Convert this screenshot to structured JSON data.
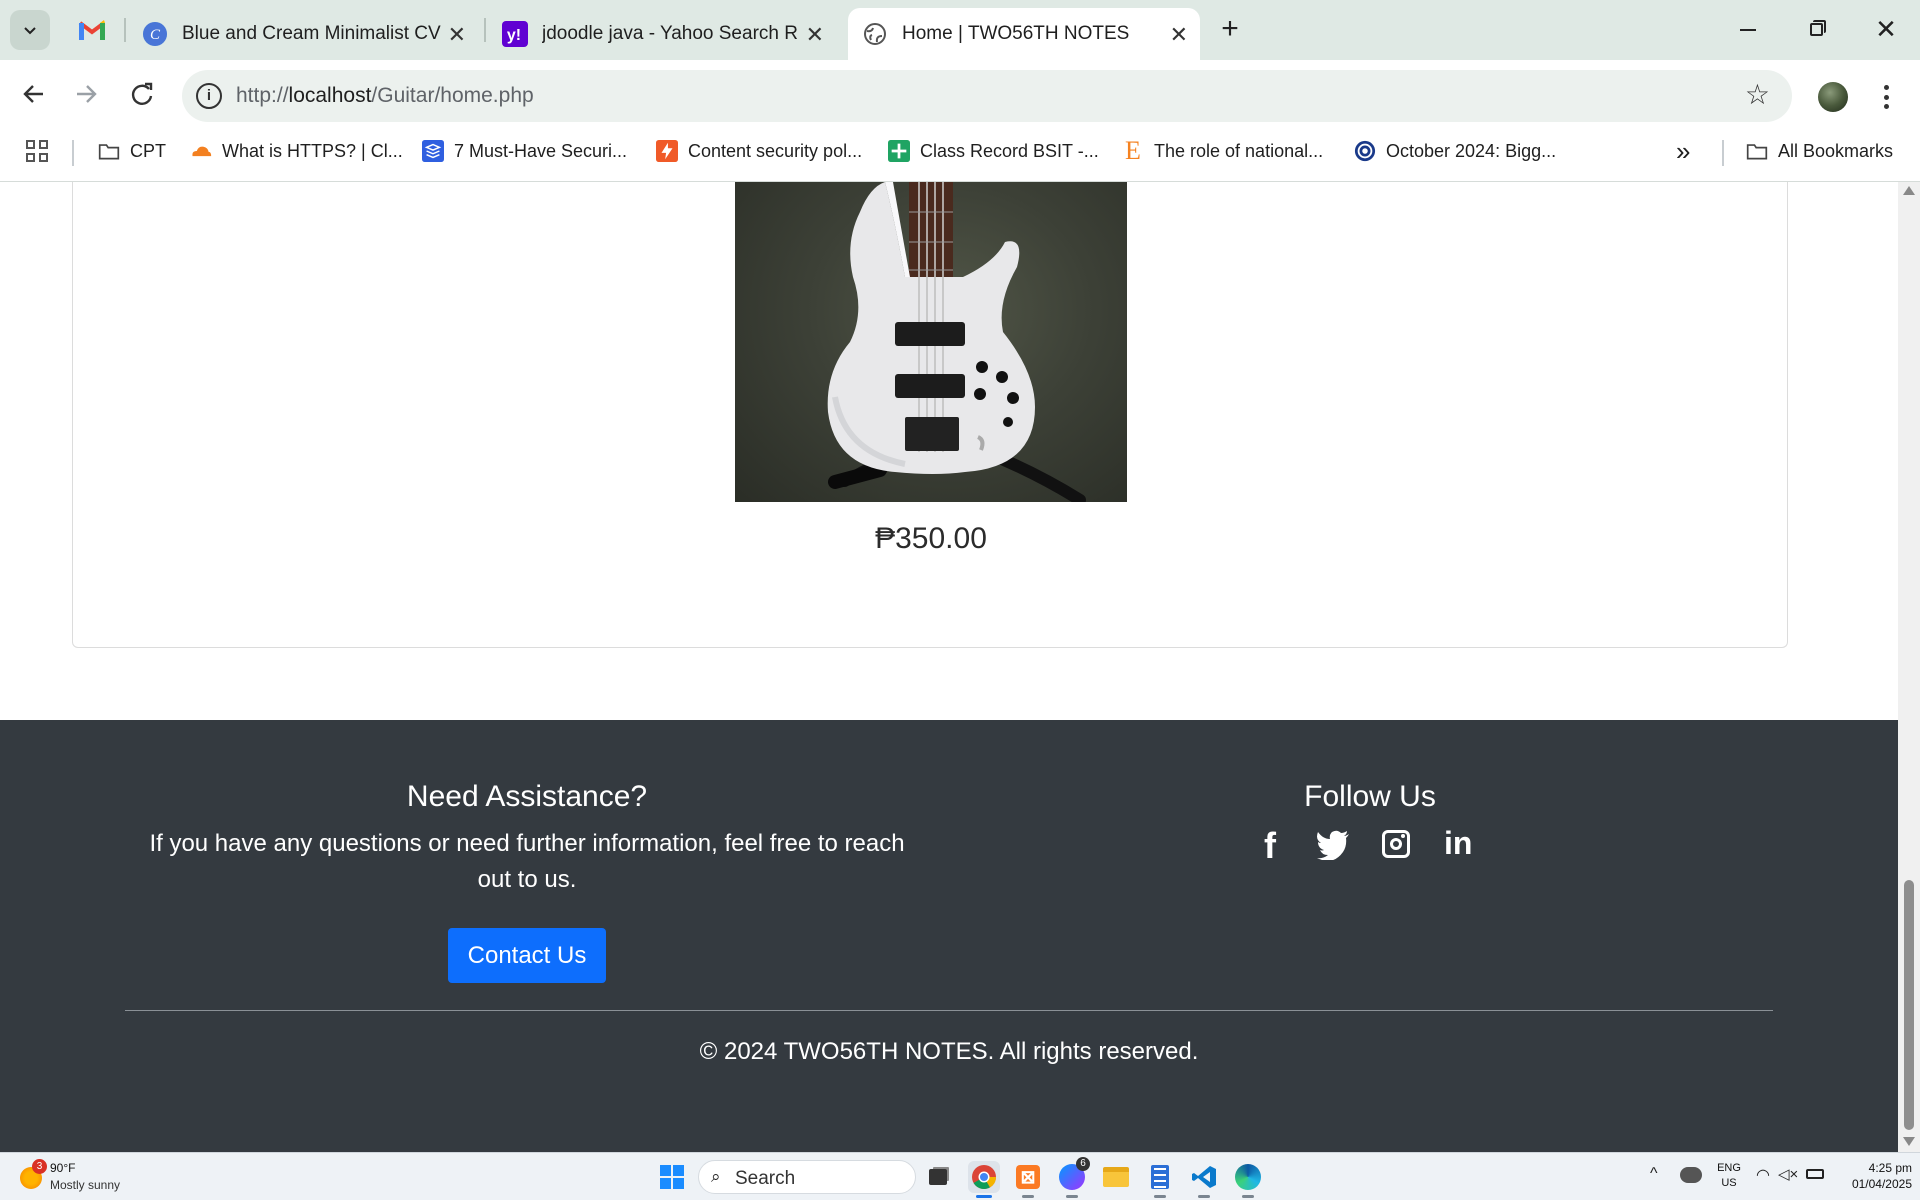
{
  "browser": {
    "tabs": [
      {
        "title": "Blue and Cream Minimalist CV R",
        "icon": "canva-icon"
      },
      {
        "title": "jdoodle java - Yahoo Search Res",
        "icon": "yahoo-icon"
      },
      {
        "title": "Home | TWO56TH NOTES",
        "icon": "globe-icon",
        "active": true
      }
    ],
    "url_prefix": "http://",
    "url_host": "localhost",
    "url_path": "/Guitar/home.php",
    "bookmarks": [
      {
        "label": "CPT",
        "icon": "folder-icon"
      },
      {
        "label": "What is HTTPS? | Cl...",
        "icon": "cloudflare-icon"
      },
      {
        "label": "7 Must-Have Securi...",
        "icon": "stack-icon"
      },
      {
        "label": "Content security pol...",
        "icon": "bolt-icon"
      },
      {
        "label": "Class Record BSIT -...",
        "icon": "sheets-icon"
      },
      {
        "label": "The role of national...",
        "icon": "e-icon"
      },
      {
        "label": "October 2024: Bigg...",
        "icon": "circle-logo-icon"
      }
    ],
    "all_bookmarks": "All Bookmarks",
    "overflow": "»"
  },
  "product": {
    "price": "₱350.00"
  },
  "footer": {
    "assist_title": "Need Assistance?",
    "assist_text_1": "If you have any questions or need further information, feel free to reach",
    "assist_text_2": "out to us.",
    "contact_button": "Contact Us",
    "follow_title": "Follow Us",
    "copyright": "© 2024 TWO56TH NOTES. All rights reserved."
  },
  "taskbar": {
    "weather_temp": "90°F",
    "weather_desc": "Mostly sunny",
    "weather_badge": "3",
    "search_placeholder": "Search",
    "messenger_badge": "6",
    "lang": "ENG",
    "region": "US",
    "time": "4:25 pm",
    "date": "01/04/2025"
  },
  "colors": {
    "footer_bg": "#343a40",
    "button_blue": "#0d6efd",
    "tabstrip_bg": "#dfe9e4"
  }
}
